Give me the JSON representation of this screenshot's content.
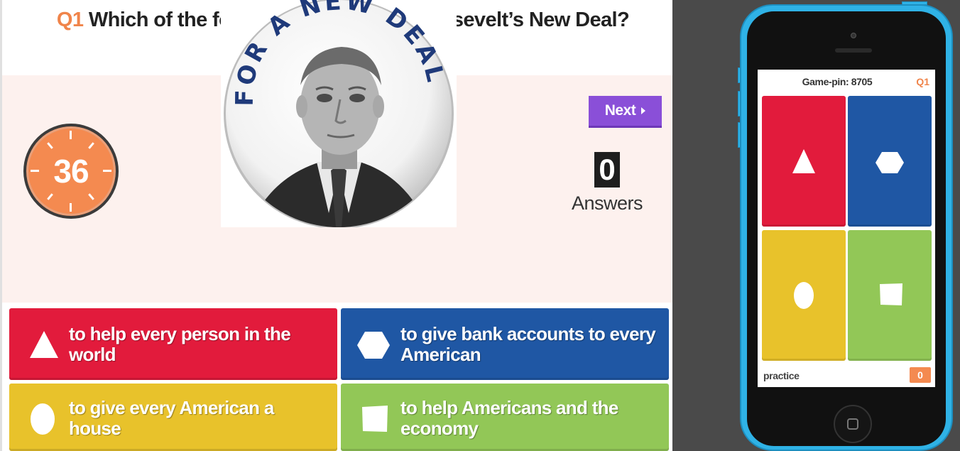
{
  "question": {
    "number": "Q1",
    "text": "Which of the following was part of Roosevelt’s New Deal?"
  },
  "media": {
    "badge_text": "FOR A NEW DEAL"
  },
  "timer": {
    "value": "36"
  },
  "controls": {
    "next_label": "Next"
  },
  "answers_count": {
    "value": "0",
    "label": "Answers"
  },
  "answers": [
    {
      "shape": "triangle-icon",
      "color": "#e21b3c",
      "text": "to help every person in the world"
    },
    {
      "shape": "hexagon-icon",
      "color": "#1f57a4",
      "text": "to give bank accounts to every American"
    },
    {
      "shape": "circle-icon",
      "color": "#e8c22b",
      "text": "to give every American a house"
    },
    {
      "shape": "square-icon",
      "color": "#92c757",
      "text": "to help Americans and the economy"
    }
  ],
  "phone": {
    "game_pin": "Game-pin: 8705",
    "question_label": "Q1",
    "mode_label": "practice",
    "score": "0"
  },
  "colors": {
    "accent": "#f0844a",
    "next_button": "#8a4fd8",
    "phone_body": "#2fb2e6"
  }
}
